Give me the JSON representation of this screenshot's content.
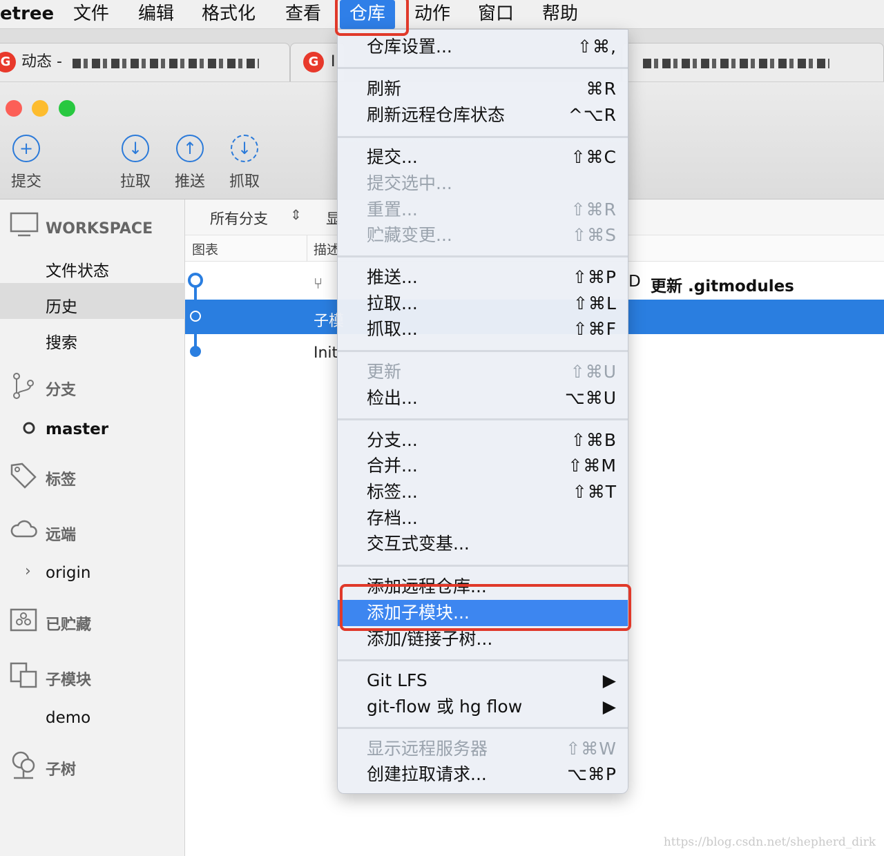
{
  "menubar": {
    "app": "etree",
    "items": [
      "文件",
      "编辑",
      "格式化",
      "查看",
      "仓库",
      "动作",
      "窗口",
      "帮助"
    ]
  },
  "browser": {
    "tab1_title": "动态 -",
    "tab2_title": "I",
    "favicon_letter": "G"
  },
  "toolbar": {
    "commit": "提交",
    "pull": "拉取",
    "push": "推送",
    "fetch": "抓取"
  },
  "sidebar": {
    "workspace": "WORKSPACE",
    "file_status": "文件状态",
    "history": "历史",
    "search": "搜索",
    "branches": "分支",
    "branch_master": "master",
    "tags": "标签",
    "remotes": "远端",
    "remote_origin": "origin",
    "stashes": "已贮藏",
    "submodules": "子模块",
    "submodule_demo": "demo",
    "subtrees": "子树"
  },
  "main": {
    "branch_filter": "所有分支",
    "show_label": "显",
    "col_graph": "图表",
    "col_desc": "描述",
    "commits": [
      {
        "prefix": "D",
        "message": "更新 .gitmodules"
      },
      {
        "message": "子模"
      },
      {
        "message": "Init"
      }
    ]
  },
  "menu": {
    "items": [
      {
        "label": "仓库设置...",
        "shortcut": "⇧⌘,"
      },
      {
        "label": "刷新",
        "shortcut": "⌘R"
      },
      {
        "label": "刷新远程仓库状态",
        "shortcut": "^⌥R"
      },
      {
        "label": "提交...",
        "shortcut": "⇧⌘C"
      },
      {
        "label": "提交选中...",
        "shortcut": ""
      },
      {
        "label": "重置...",
        "shortcut": "⇧⌘R"
      },
      {
        "label": "贮藏变更...",
        "shortcut": "⇧⌘S"
      },
      {
        "label": "推送...",
        "shortcut": "⇧⌘P"
      },
      {
        "label": "拉取...",
        "shortcut": "⇧⌘L"
      },
      {
        "label": "抓取...",
        "shortcut": "⇧⌘F"
      },
      {
        "label": "更新",
        "shortcut": "⇧⌘U"
      },
      {
        "label": "检出...",
        "shortcut": "⌥⌘U"
      },
      {
        "label": "分支...",
        "shortcut": "⇧⌘B"
      },
      {
        "label": "合并...",
        "shortcut": "⇧⌘M"
      },
      {
        "label": "标签...",
        "shortcut": "⇧⌘T"
      },
      {
        "label": "存档...",
        "shortcut": ""
      },
      {
        "label": "交互式变基...",
        "shortcut": ""
      },
      {
        "label": "添加远程仓库...",
        "shortcut": ""
      },
      {
        "label": "添加子模块...",
        "shortcut": ""
      },
      {
        "label": "添加/链接子树...",
        "shortcut": ""
      },
      {
        "label": "Git LFS",
        "shortcut": "▶"
      },
      {
        "label": "git-flow 或 hg flow",
        "shortcut": "▶"
      },
      {
        "label": "显示远程服务器",
        "shortcut": "⇧⌘W"
      },
      {
        "label": "创建拉取请求...",
        "shortcut": "⌥⌘P"
      }
    ]
  },
  "watermark": "https://blog.csdn.net/shepherd_dirk"
}
